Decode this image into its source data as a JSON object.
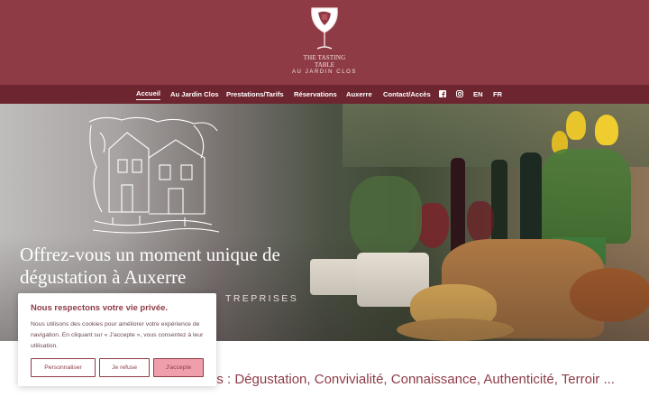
{
  "brand": {
    "name_line1": "THE TASTING",
    "name_line2": "TABLE",
    "name_line3": "AU JARDIN CLOS",
    "logo_icon": "wine-glass-logo-icon"
  },
  "nav": {
    "items": [
      {
        "label": "Accueil",
        "active": true
      },
      {
        "label": "Au Jardin Clos"
      },
      {
        "label": "Prestations/Tarifs"
      },
      {
        "label": "Réservations"
      },
      {
        "label": "Auxerre"
      },
      {
        "label": "Contact/Accès"
      }
    ],
    "social_icons": [
      "facebook-icon",
      "instagram-icon"
    ],
    "languages": [
      "EN",
      "FR"
    ]
  },
  "hero": {
    "title": "Offrez-vous un moment unique de dégustation à Auxerre",
    "subtitle": "TREPRISES"
  },
  "cookie_banner": {
    "title": "Nous respectons votre vie privée.",
    "text": "Nous utilisons des cookies pour améliorer votre expérience de navigation. En cliquant sur « J'accepte », vous consentez à leur utilisation.",
    "buttons": {
      "customize": "Personnaliser",
      "refuse": "Je refuse",
      "accept": "J'accepte"
    }
  },
  "section": {
    "title": "os : Dégustation, Convivialité, Connaissance, Authenticité, Terroir ..."
  },
  "colors": {
    "header_bg": "#8e3b45",
    "nav_bg": "#6d2530",
    "accent": "#8e3b45",
    "accept_button": "#ee9fab"
  }
}
